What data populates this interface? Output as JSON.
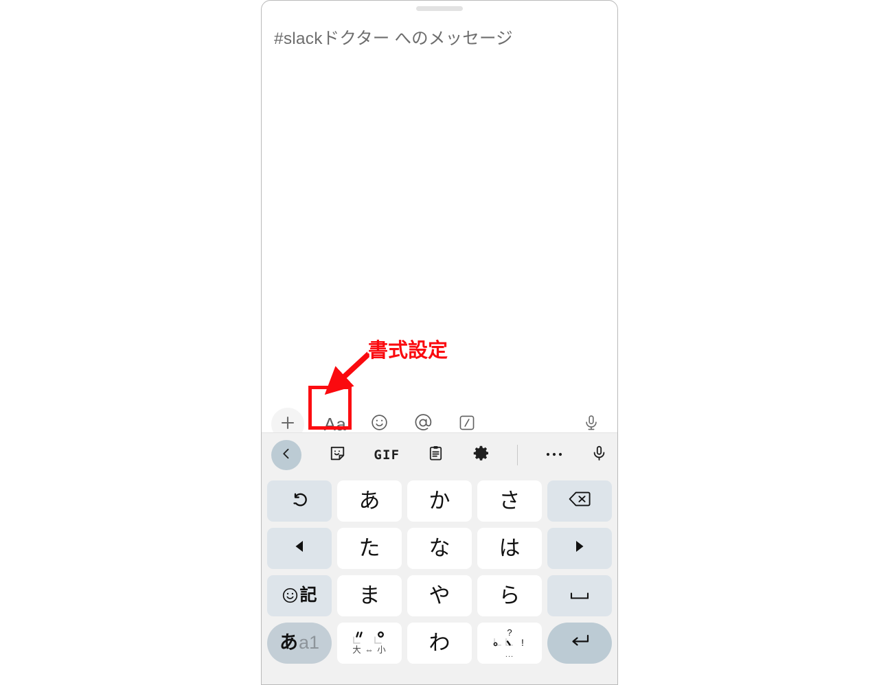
{
  "app": {
    "platform": "slack-mobile-composer",
    "frame_label": "phone-screen"
  },
  "composer": {
    "placeholder": "#slackドクター へのメッセージ",
    "value": "",
    "toolbar": [
      {
        "name": "plus-button",
        "icon": "plus-icon",
        "label": "+"
      },
      {
        "name": "formatting-button",
        "icon": "text-format-icon",
        "label": "Aa"
      },
      {
        "name": "emoji-button",
        "icon": "smiley-icon",
        "label": ""
      },
      {
        "name": "mention-button",
        "icon": "at-sign-icon",
        "label": "@"
      },
      {
        "name": "slash-command-button",
        "icon": "slash-command-icon",
        "label": "/"
      },
      {
        "name": "voice-message-button",
        "icon": "microphone-icon",
        "label": ""
      }
    ]
  },
  "annotation": {
    "label": "書式設定",
    "color": "#fa0a0f",
    "outline_color": "#ffffff",
    "target": "formatting-button",
    "arrow": "down-left-arrow"
  },
  "keyboard": {
    "type": "japanese-12key-flick",
    "background": "#f1f1f1",
    "toolbar": [
      {
        "name": "back-button",
        "icon": "chevron-left-icon",
        "label": ""
      },
      {
        "name": "sticker-button",
        "icon": "sticker-icon",
        "label": ""
      },
      {
        "name": "gif-button",
        "icon": "gif-icon",
        "label": "GIF"
      },
      {
        "name": "clipboard-button",
        "icon": "clipboard-icon",
        "label": ""
      },
      {
        "name": "settings-button",
        "icon": "gear-icon",
        "label": ""
      },
      {
        "name": "more-button",
        "icon": "ellipsis-icon",
        "label": ""
      },
      {
        "name": "voice-input-button",
        "icon": "microphone-icon",
        "label": ""
      }
    ],
    "rows": [
      [
        {
          "name": "undo-key",
          "label": "↺",
          "style": "side",
          "icon": "undo-icon"
        },
        {
          "name": "key-a",
          "label": "あ",
          "style": "char"
        },
        {
          "name": "key-ka",
          "label": "か",
          "style": "char"
        },
        {
          "name": "key-sa",
          "label": "さ",
          "style": "char"
        },
        {
          "name": "backspace-key",
          "label": "⌫",
          "style": "side",
          "icon": "backspace-icon"
        }
      ],
      [
        {
          "name": "cursor-left-key",
          "label": "◀",
          "style": "side",
          "icon": "arrow-left-icon"
        },
        {
          "name": "key-ta",
          "label": "た",
          "style": "char"
        },
        {
          "name": "key-na",
          "label": "な",
          "style": "char"
        },
        {
          "name": "key-ha",
          "label": "は",
          "style": "char"
        },
        {
          "name": "cursor-right-key",
          "label": "▶",
          "style": "side",
          "icon": "arrow-right-icon"
        }
      ],
      [
        {
          "name": "emoji-symbol-key",
          "label": "☺記",
          "style": "side",
          "icon": "emoji-symbol-icon"
        },
        {
          "name": "key-ma",
          "label": "ま",
          "style": "char"
        },
        {
          "name": "key-ya",
          "label": "や",
          "style": "char"
        },
        {
          "name": "key-ra",
          "label": "ら",
          "style": "char"
        },
        {
          "name": "space-key",
          "label": "␣",
          "style": "side",
          "icon": "space-icon"
        }
      ],
      [
        {
          "name": "input-mode-key",
          "label": "あa1",
          "style": "pill-gray",
          "jp": "あ",
          "en": "a1"
        },
        {
          "name": "dakuten-key",
          "label": "゛゜ 大⇔小",
          "style": "char",
          "sub": "大 ⇔ 小"
        },
        {
          "name": "key-wa",
          "label": "わ",
          "style": "char"
        },
        {
          "name": "punctuation-key",
          "label": "、。?!",
          "style": "char",
          "sub": "..."
        },
        {
          "name": "enter-key",
          "label": "↵",
          "style": "pill",
          "icon": "enter-icon"
        }
      ]
    ]
  }
}
